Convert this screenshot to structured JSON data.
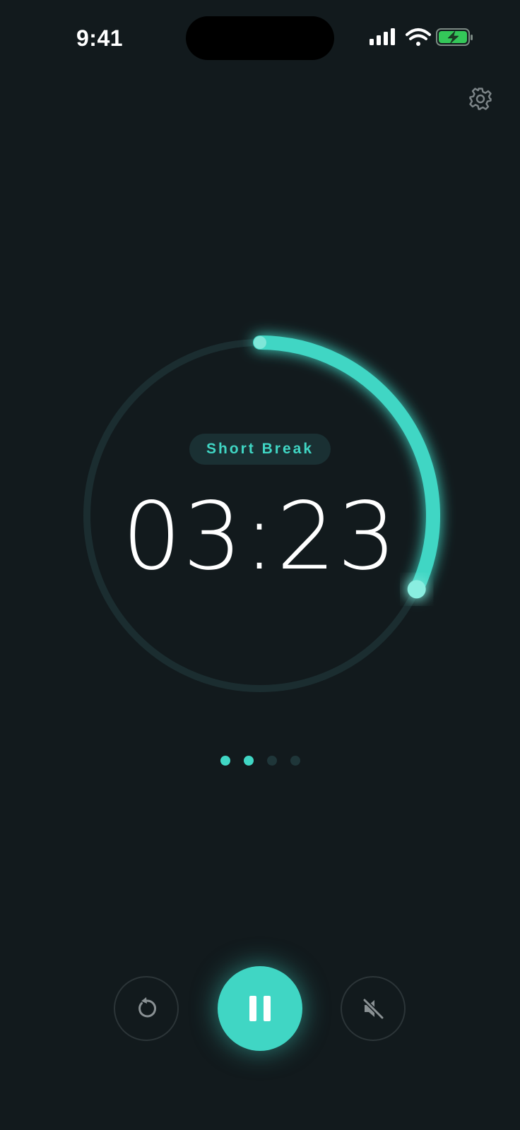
{
  "status_bar": {
    "time": "9:41",
    "icons": [
      "signal-icon",
      "wifi-icon",
      "battery-charging-icon"
    ]
  },
  "header": {
    "settings_icon": "gear-icon"
  },
  "timer": {
    "mode_label": "Short Break",
    "time": "03:23",
    "progress_fraction": 0.32,
    "accent_color": "#40d6c4",
    "track_color": "#1b2d30"
  },
  "sessions": {
    "completed": [
      true,
      true,
      false,
      false
    ]
  },
  "controls": {
    "reset_icon": "reset-icon",
    "pause_icon": "pause-icon",
    "mute_icon": "speaker-muted-icon"
  }
}
